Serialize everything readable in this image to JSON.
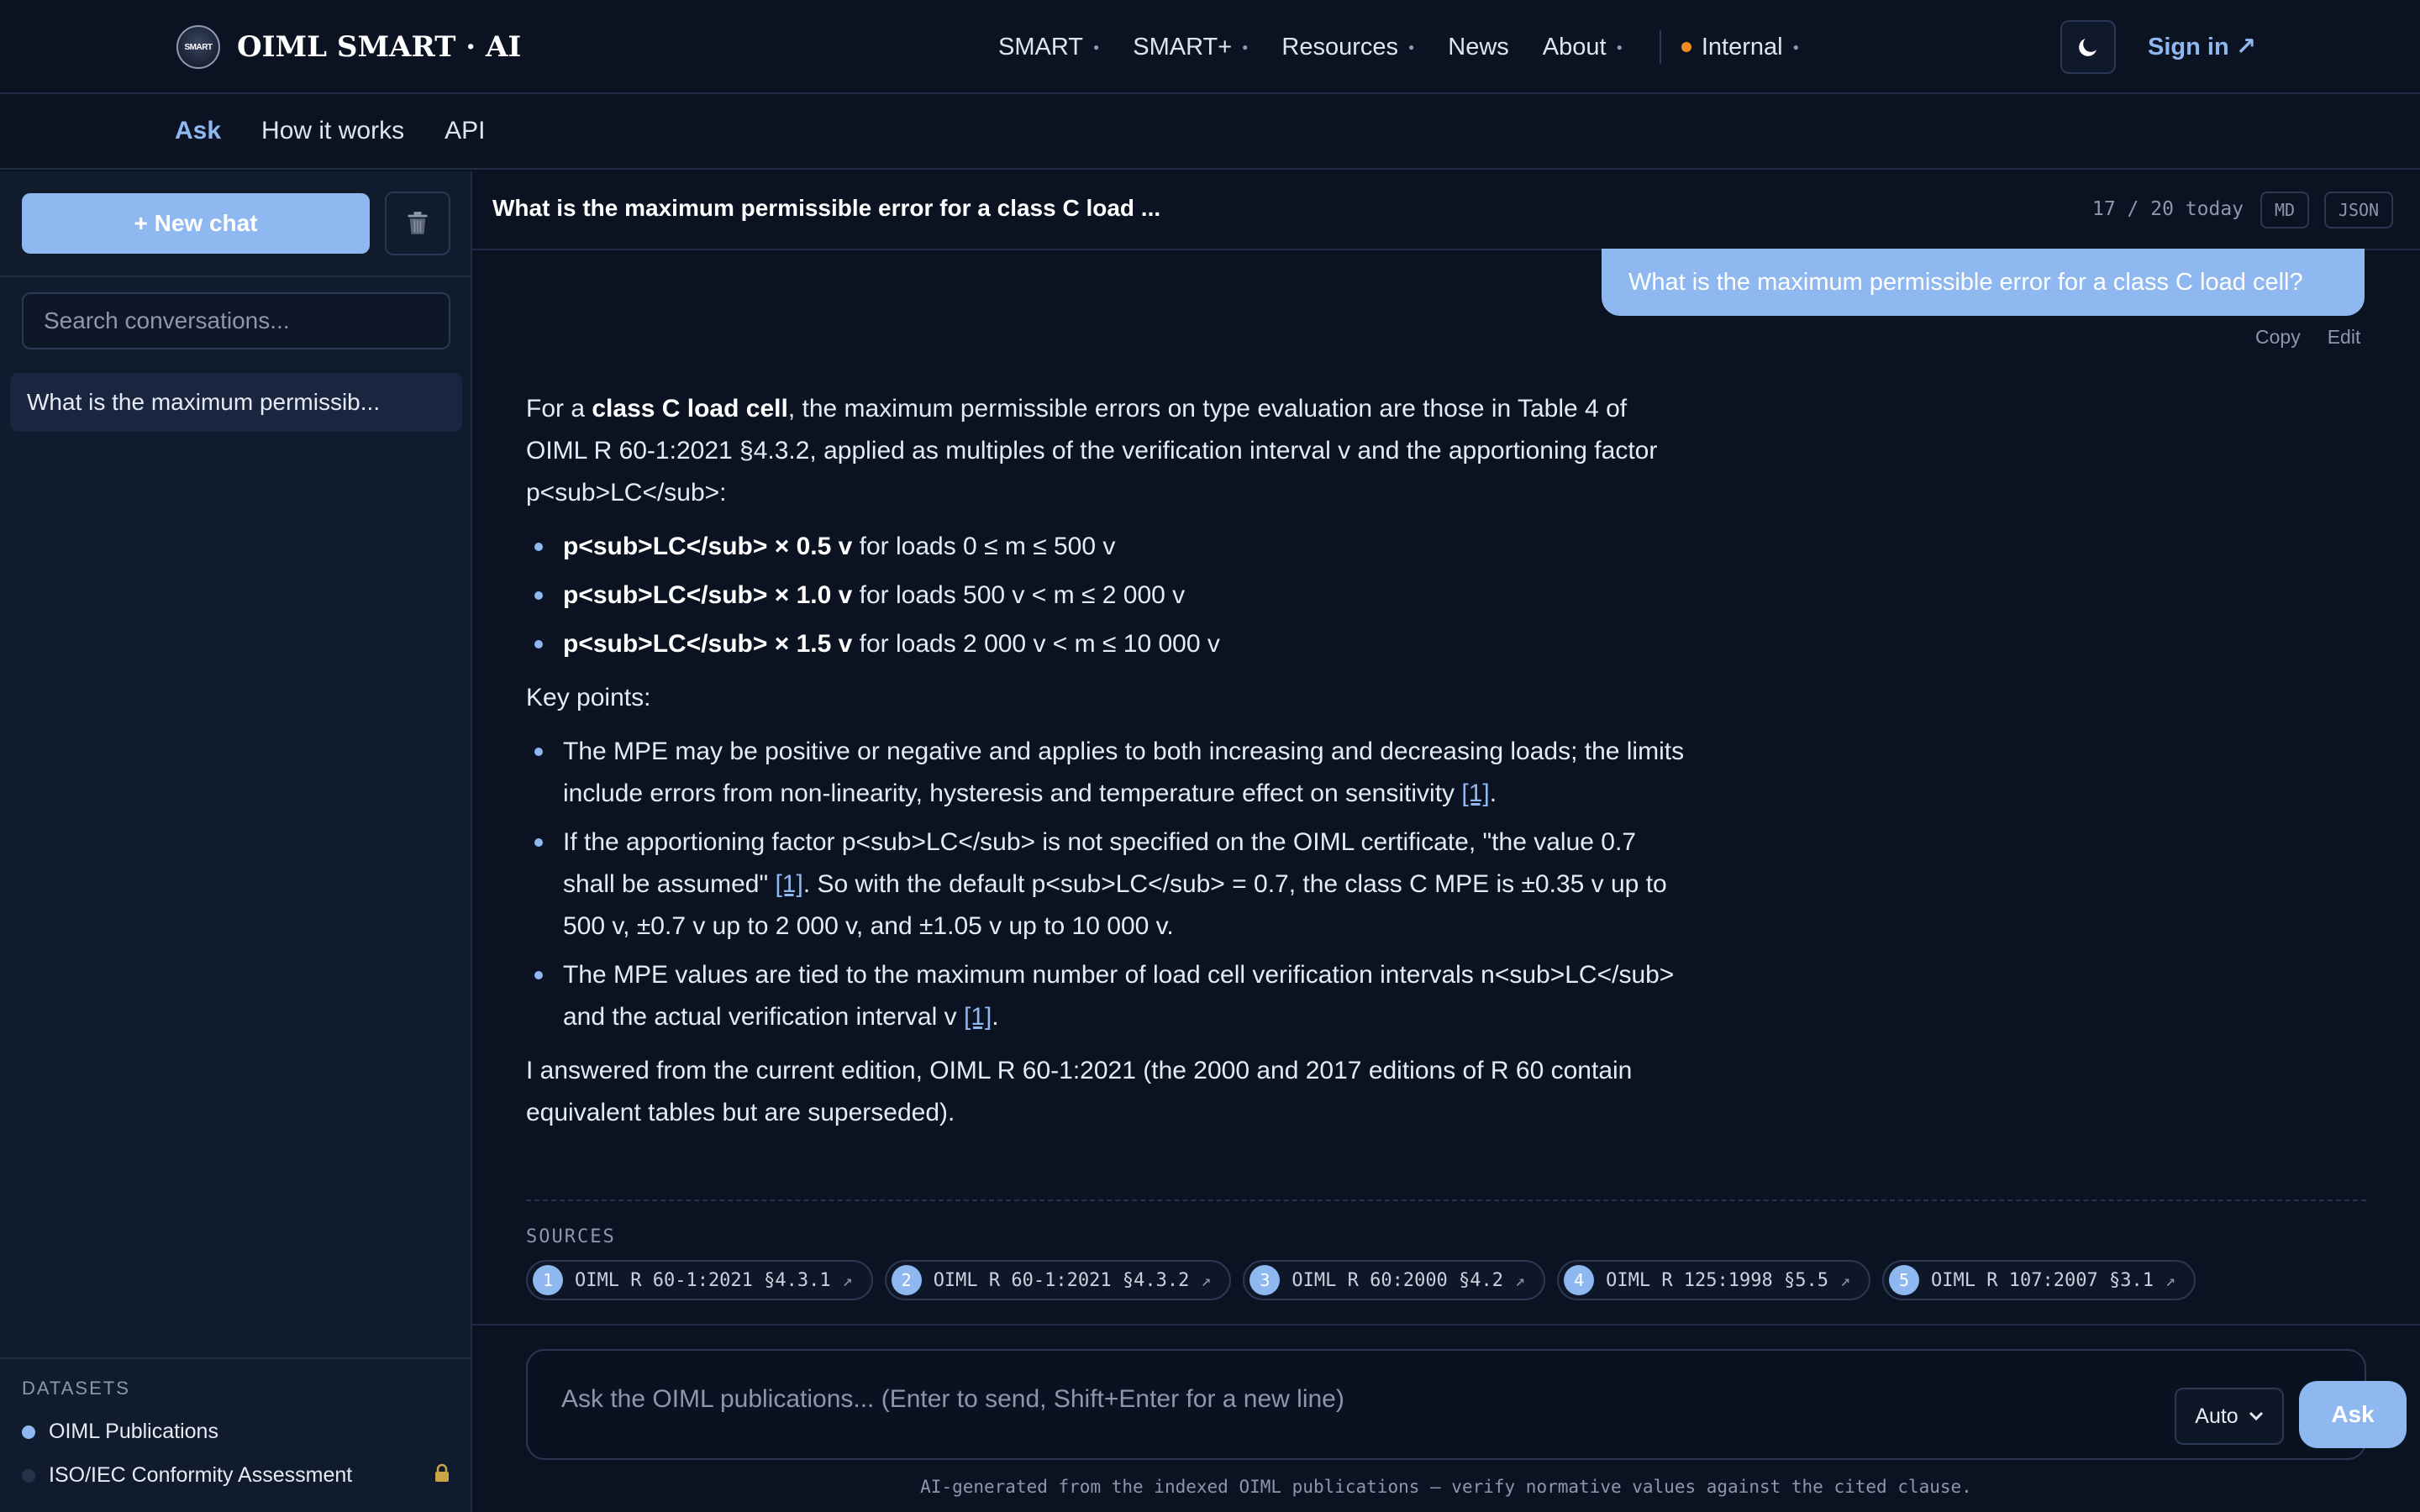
{
  "brand": {
    "logo_text": "SMART",
    "name": "OIML SMART · AI"
  },
  "nav": [
    {
      "label": "SMART",
      "dropdown": true
    },
    {
      "label": "SMART+",
      "dropdown": true
    },
    {
      "label": "Resources",
      "dropdown": true
    },
    {
      "label": "News",
      "dropdown": false
    },
    {
      "label": "About",
      "dropdown": true
    },
    {
      "label": "Internal",
      "dropdown": true,
      "status": "orange"
    }
  ],
  "theme_toggle_icon": "moon-icon",
  "sign_in": "Sign in ↗",
  "subnav": [
    {
      "label": "Ask",
      "active": true
    },
    {
      "label": "How it works",
      "active": false
    },
    {
      "label": "API",
      "active": false
    }
  ],
  "sidebar": {
    "new_chat": "+ New chat",
    "search_placeholder": "Search conversations...",
    "conversations": [
      "What is the maximum permissib..."
    ],
    "datasets_label": "DATASETS",
    "datasets": [
      {
        "name": "OIML Publications",
        "active": true,
        "locked": false
      },
      {
        "name": "ISO/IEC Conformity Assessment",
        "active": false,
        "locked": true
      }
    ]
  },
  "chat": {
    "title": "What is the maximum permissible error for a class C load ...",
    "usage": "17 / 20 today",
    "export_md": "MD",
    "export_json": "JSON",
    "user_message": "What is the maximum permissible error for a class C load cell?",
    "copy": "Copy",
    "edit": "Edit",
    "answer": {
      "intro_a": "For a ",
      "intro_b": "class C load cell",
      "intro_c": ", the maximum permissible errors on type evaluation are those in Table 4 of OIML R 60-1:2021 §4.3.2, applied as multiples of the verification interval v and the apportioning factor p<sub>LC</sub>:",
      "mpe_list": [
        {
          "bold": "p<sub>LC</sub> × 0.5 v",
          "text": " for loads 0 ≤ m ≤ 500 v"
        },
        {
          "bold": "p<sub>LC</sub> × 1.0 v",
          "text": " for loads 500 v < m ≤ 2 000 v"
        },
        {
          "bold": "p<sub>LC</sub> × 1.5 v",
          "text": " for loads 2 000 v < m ≤ 10 000 v"
        }
      ],
      "key_points_label": "Key points:",
      "kp1_text": "The MPE may be positive or negative and applies to both increasing and decreasing loads; the limits include errors from non-linearity, hysteresis and temperature effect on sensitivity ",
      "kp1_cite": "[1]",
      "kp1_end": ".",
      "kp2_text": "If the apportioning factor p<sub>LC</sub> is not specified on the OIML certificate, \"the value 0.7 shall be assumed\" ",
      "kp2_cite": "[1]",
      "kp2_end": ". So with the default p<sub>LC</sub> = 0.7, the class C MPE is ±0.35 v up to 500 v, ±0.7 v up to 2 000 v, and ±1.05 v up to 10 000 v.",
      "kp3_text": "The MPE values are tied to the maximum number of load cell verification intervals n<sub>LC</sub> and the actual verification interval v ",
      "kp3_cite": "[1]",
      "kp3_end": ".",
      "closing": "I answered from the current edition, OIML R 60-1:2021 (the 2000 and 2017 editions of R 60 contain equivalent tables but are superseded)."
    },
    "sources_label": "SOURCES",
    "sources": [
      {
        "n": "1",
        "label": "OIML R 60-1:2021 §4.3.1"
      },
      {
        "n": "2",
        "label": "OIML R 60-1:2021 §4.3.2"
      },
      {
        "n": "3",
        "label": "OIML R 60:2000 §4.2"
      },
      {
        "n": "4",
        "label": "OIML R 125:1998 §5.5"
      },
      {
        "n": "5",
        "label": "OIML R 107:2007 §3.1"
      }
    ],
    "composer_placeholder": "Ask the OIML publications... (Enter to send, Shift+Enter for a new line)",
    "mode": "Auto",
    "ask": "Ask",
    "disclaimer": "AI-generated from the indexed OIML publications — verify normative values against the cited clause."
  },
  "colors": {
    "accent": "#8fb8f0",
    "background": "#0b1322",
    "sidebar": "#111b2e",
    "status_internal": "#f08a24"
  }
}
